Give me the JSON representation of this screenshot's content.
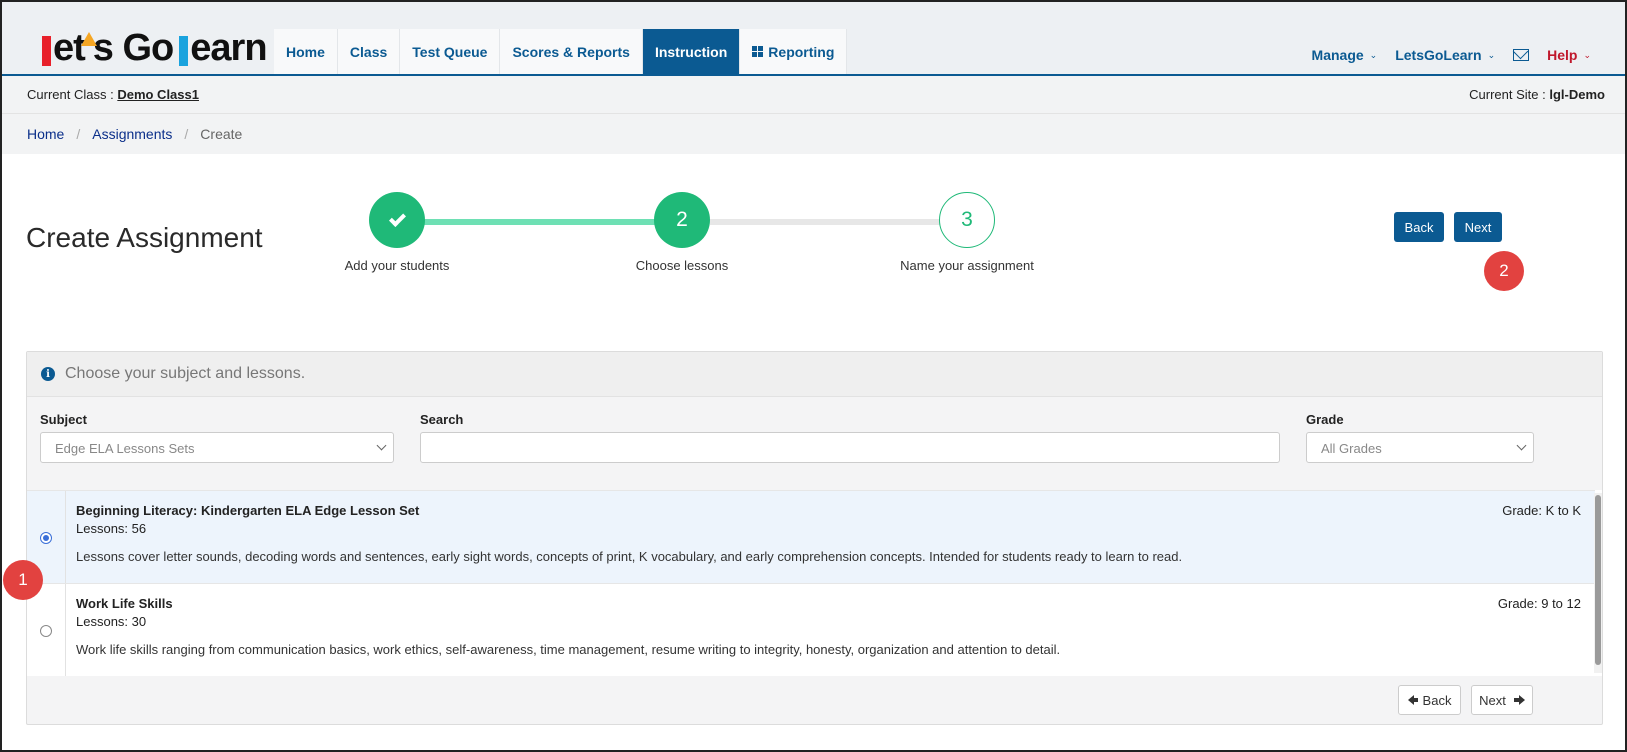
{
  "logo": {
    "text": "Let's Go Learn"
  },
  "nav": {
    "tabs": [
      {
        "label": "Home"
      },
      {
        "label": "Class"
      },
      {
        "label": "Test Queue"
      },
      {
        "label": "Scores & Reports"
      },
      {
        "label": "Instruction",
        "active": true
      },
      {
        "label": "Reporting",
        "icon": "grid-icon"
      }
    ],
    "right": {
      "manage": "Manage",
      "account": "LetsGoLearn",
      "mail_icon": "envelope-icon",
      "help": "Help"
    }
  },
  "classbar": {
    "current_class_label": "Current Class :",
    "current_class": "Demo Class1",
    "current_site_label": "Current Site :",
    "current_site": "lgl-Demo"
  },
  "breadcrumb": [
    "Home",
    "Assignments",
    "Create"
  ],
  "page": {
    "title": "Create Assignment"
  },
  "stepper": {
    "steps": [
      {
        "number": "",
        "label": "Add your students",
        "state": "done"
      },
      {
        "number": "2",
        "label": "Choose lessons",
        "state": "current"
      },
      {
        "number": "3",
        "label": "Name your assignment",
        "state": "upcoming"
      }
    ]
  },
  "top_buttons": {
    "back": "Back",
    "next": "Next"
  },
  "badges": {
    "one": "1",
    "two": "2"
  },
  "panel": {
    "heading": "Choose your subject and lessons.",
    "filters": {
      "subject_label": "Subject",
      "subject_value": "Edge ELA Lessons Sets",
      "search_label": "Search",
      "search_value": "",
      "grade_label": "Grade",
      "grade_value": "All Grades"
    },
    "items": [
      {
        "title": "Beginning Literacy: Kindergarten ELA Edge Lesson Set",
        "lessons": "Lessons: 56",
        "grade": "Grade: K to K",
        "description": "Lessons cover letter sounds, decoding words and sentences, early sight words, concepts of print, K vocabulary, and early comprehension concepts. Intended for students ready to learn to read.",
        "selected": true
      },
      {
        "title": "Work Life Skills",
        "lessons": "Lessons: 30",
        "grade": "Grade: 9 to 12",
        "description": "Work life skills ranging from communication basics, work ethics, self-awareness, time management, resume writing to integrity, honesty, organization and attention to detail.",
        "selected": false
      }
    ],
    "footer": {
      "back": "Back",
      "next": "Next"
    }
  },
  "colors": {
    "primary": "#0b5a92",
    "success": "#1fb978",
    "badge": "#e24240",
    "help": "#c0182c"
  }
}
